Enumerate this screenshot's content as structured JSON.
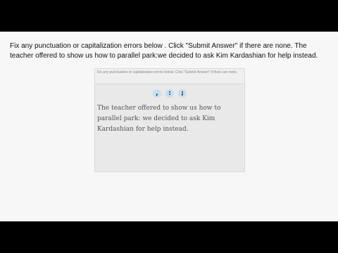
{
  "prompt": {
    "instruction": "Fix any punctuation or capitalization errors below . Click \"Submit Answer\" if there are none. The teacher offered to show us how to parallel park:we decided to ask Kim Kardashian for help instead."
  },
  "panel": {
    "header_text": "Fix any punctuation or capitalization errors below. Click \"Submit Answer\" if there are none.",
    "choices": [
      ",",
      ":",
      ";"
    ],
    "sentence": "The teacher offered to show us how to parallel park: we decided to ask Kim Kardashian for help instead."
  },
  "colors": {
    "background": "#000000",
    "frame": "#f7f7f7",
    "panel": "#e9e9e9",
    "choice_bubble": "#c5dff2"
  }
}
